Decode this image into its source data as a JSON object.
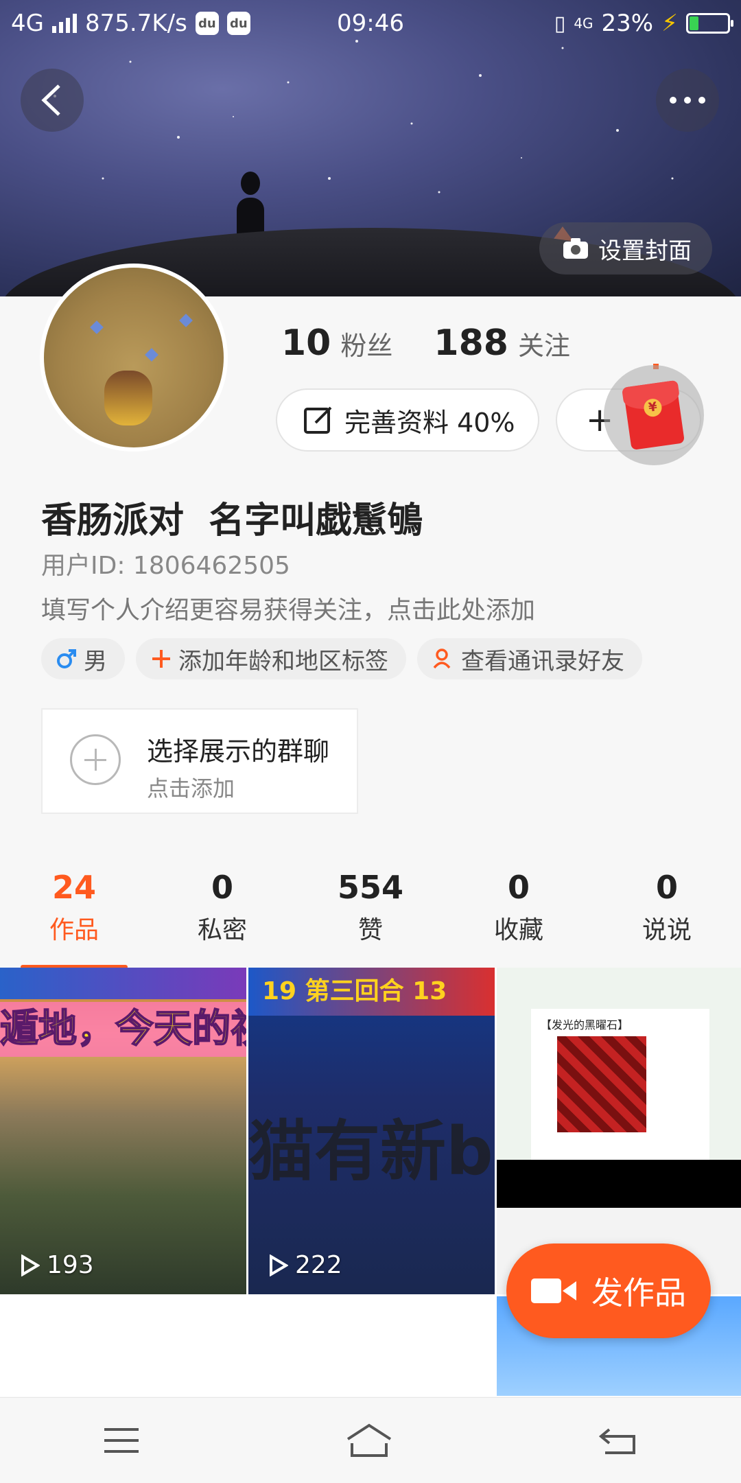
{
  "status_bar": {
    "network": "4G",
    "speed": "875.7K/s",
    "app_icons": [
      "du",
      "du"
    ],
    "time": "09:46",
    "net2": "4G",
    "battery": "23%",
    "battery_level": 0.23
  },
  "cover": {
    "set_cover_label": "设置封面"
  },
  "stats": {
    "fans_count": "10",
    "fans_label": "粉丝",
    "follow_count": "188",
    "follow_label": "关注"
  },
  "buttons": {
    "edit_profile": "完善资料 40%",
    "add_friend_plus": "+"
  },
  "profile": {
    "nickname": "香肠派对  名字叫戯䰄鴝",
    "user_id": "用户ID: 1806462505",
    "bio_hint": "填写个人介绍更容易获得关注，点击此处添加"
  },
  "tags": [
    {
      "label": "男",
      "icon": "male-icon"
    },
    {
      "label": "添加年龄和地区标签",
      "icon": "plus-icon"
    },
    {
      "label": "查看通讯录好友",
      "icon": "contacts-icon"
    }
  ],
  "group_chat": {
    "title": "选择展示的群聊",
    "subtitle": "点击添加"
  },
  "tabs": [
    {
      "count": "24",
      "label": "作品",
      "active": true
    },
    {
      "count": "0",
      "label": "私密"
    },
    {
      "count": "554",
      "label": "赞"
    },
    {
      "count": "0",
      "label": "收藏"
    },
    {
      "count": "0",
      "label": "说说"
    }
  ],
  "videos": [
    {
      "plays": "193",
      "overlay": "遁地，今天的视"
    },
    {
      "plays": "222",
      "overlay_top": "19 第三回合 13",
      "overlay_big": "猫有新bu"
    },
    {
      "overlay": "【发光的黑曜石】"
    }
  ],
  "fab": {
    "label": "发作品"
  },
  "colors": {
    "accent": "#ff5a1f"
  }
}
